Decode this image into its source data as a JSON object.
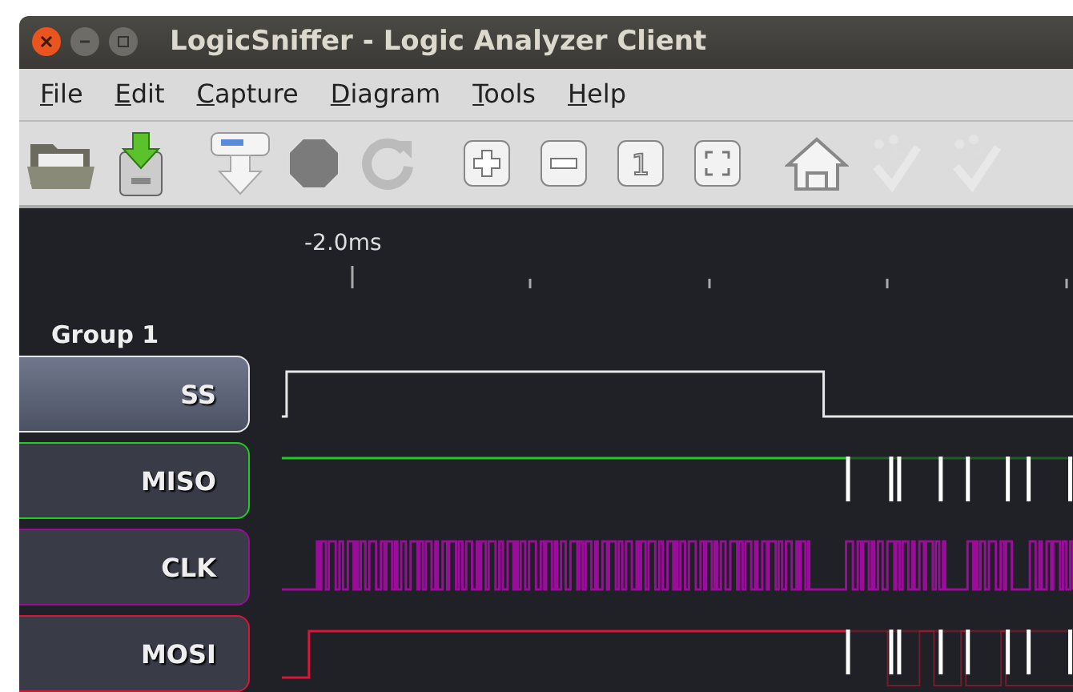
{
  "window": {
    "title": "LogicSniffer - Logic Analyzer Client"
  },
  "menu": [
    "File",
    "Edit",
    "Capture",
    "Diagram",
    "Tools",
    "Help"
  ],
  "toolbar": [
    {
      "kind": "open"
    },
    {
      "kind": "save"
    },
    {
      "kind": "capture"
    },
    {
      "kind": "stop"
    },
    {
      "kind": "repeat"
    },
    {
      "kind": "zoom-in"
    },
    {
      "kind": "zoom-out"
    },
    {
      "kind": "zoom-original",
      "label": "1"
    },
    {
      "kind": "zoom-fit"
    },
    {
      "kind": "home"
    },
    {
      "kind": "marker"
    },
    {
      "kind": "marker"
    }
  ],
  "timeline": {
    "label": "-2.0ms"
  },
  "group": {
    "name": "Group 1"
  },
  "channels": [
    {
      "name": "SS",
      "color": "#e8e8e8",
      "selected": true
    },
    {
      "name": "MISO",
      "color": "#22cc22",
      "selected": false
    },
    {
      "name": "CLK",
      "color": "#9a0c9a",
      "selected": false
    },
    {
      "name": "MOSI",
      "color": "#d8163a",
      "selected": false
    }
  ]
}
